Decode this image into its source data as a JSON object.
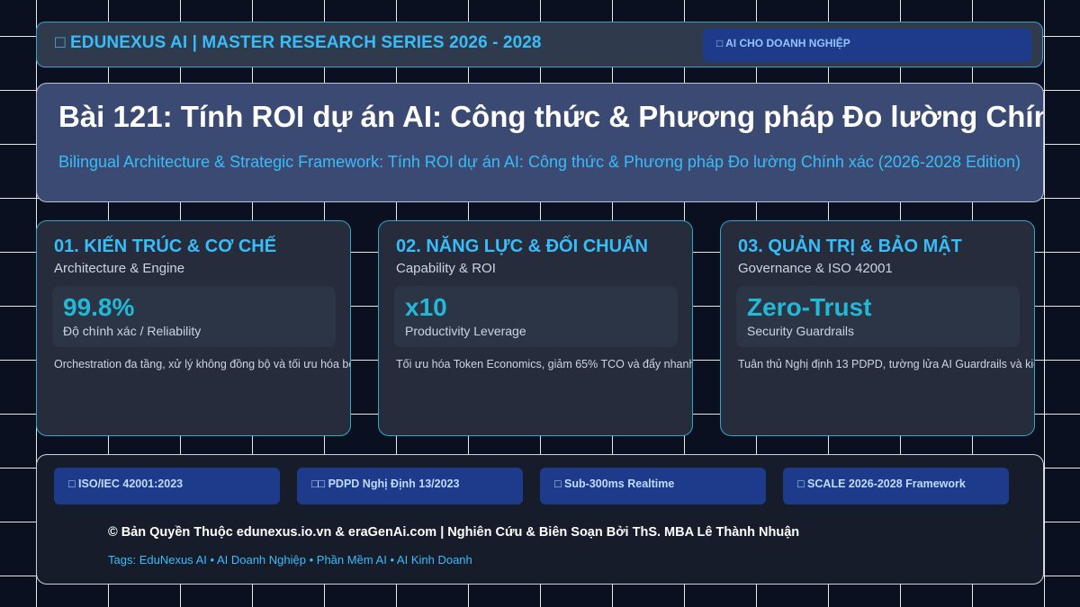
{
  "header": {
    "icon": "□",
    "title": "EDUNEXUS AI | MASTER RESEARCH SERIES 2026 - 2028",
    "badge_icon": "□",
    "badge": "AI CHO DOANH NGHIỆP"
  },
  "hero": {
    "title": "Bài 121: Tính ROI dự án AI: Công thức & Phương pháp Đo lường Chính xác",
    "subtitle": "Bilingual Architecture & Strategic Framework: Tính ROI dự án AI: Công thức & Phương pháp Đo lường Chính xác (2026-2028 Edition)"
  },
  "cards": [
    {
      "title": "01. KIẾN TRÚC & CƠ CHẾ",
      "subtitle": "Architecture & Engine",
      "metric_value": "99.8%",
      "metric_label": "Độ chính xác / Reliability",
      "description": "Orchestration đa tầng, xử lý không đồng bộ và tối ưu hóa bộ nhớ"
    },
    {
      "title": "02. NĂNG LỰC & ĐỐI CHUẨN",
      "subtitle": "Capability & ROI",
      "metric_value": "x10",
      "metric_label": "Productivity Leverage",
      "description": "Tối ưu hóa Token Economics, giảm 65% TCO và đẩy nhanh chu kỳ"
    },
    {
      "title": "03. QUẢN TRỊ & BẢO MẬT",
      "subtitle": "Governance & ISO 42001",
      "metric_value": "Zero-Trust",
      "metric_label": "Security Guardrails",
      "description": "Tuân thủ Nghị định 13 PDPD, tường lửa AI Guardrails và kiểm toán"
    }
  ],
  "footer": {
    "badges": [
      {
        "icon": "□",
        "label": "ISO/IEC 42001:2023"
      },
      {
        "icon": "□□",
        "label": "PDPD Nghị Định 13/2023"
      },
      {
        "icon": "□",
        "label": "Sub-300ms Realtime"
      },
      {
        "icon": "□",
        "label": "SCALE 2026-2028 Framework"
      }
    ],
    "copyright": "© Bản Quyền Thuộc edunexus.io.vn & eraGenAi.com | Nghiên Cứu & Biên Soạn Bởi ThS. MBA Lê Thành Nhuận",
    "tags_prefix": "Tags:",
    "tags": [
      "EduNexus AI",
      "AI Doanh Nghiệp",
      "Phần Mềm AI",
      "AI Kinh Doanh"
    ]
  },
  "colors": {
    "accent": "#38bdf8",
    "metric": "#22b8d6",
    "badge_bg": "#1e3a8a",
    "background": "#0b1020"
  }
}
